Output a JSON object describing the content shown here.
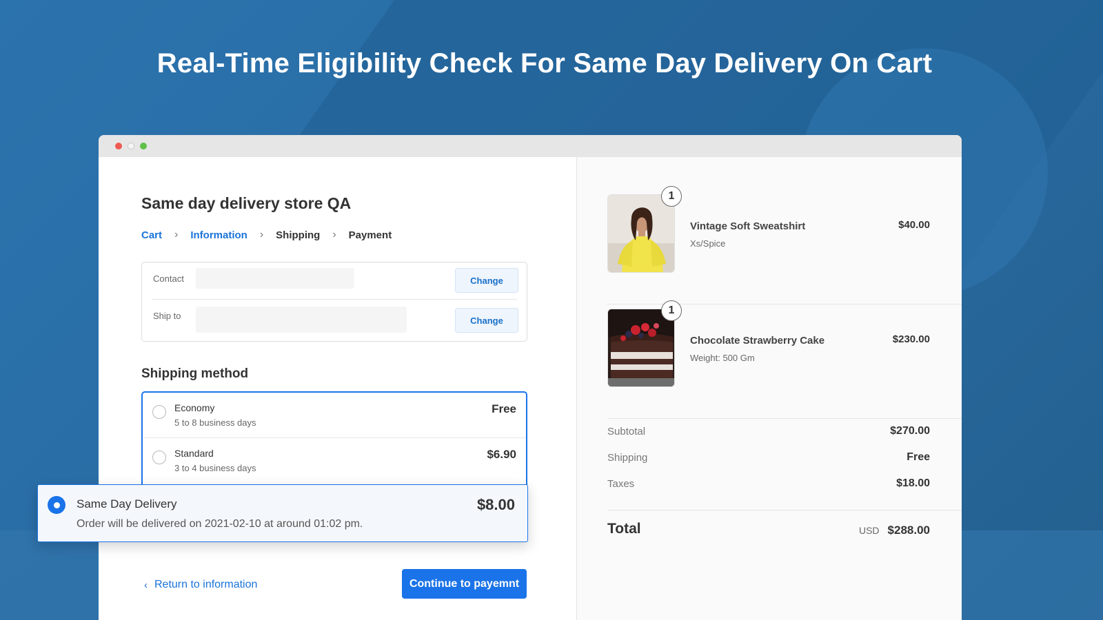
{
  "hero": {
    "title": "Real-Time Eligibility Check For Same Day Delivery On Cart"
  },
  "checkout": {
    "store_name": "Same day delivery store QA",
    "breadcrumb": [
      {
        "label": "Cart"
      },
      {
        "label": "Information"
      },
      {
        "label": "Shipping"
      },
      {
        "label": "Payment"
      }
    ],
    "contact": {
      "label": "Contact",
      "value": "",
      "action": "Change"
    },
    "ship_to": {
      "label": "Ship to",
      "value": "",
      "action": "Change"
    },
    "shipping_method_title": "Shipping method",
    "options": [
      {
        "name": "Economy",
        "desc": "5 to 8 business days",
        "price": "Free",
        "selected": false
      },
      {
        "name": "Standard",
        "desc": "3 to 4 business days",
        "price": "$6.90",
        "selected": false
      }
    ],
    "same_day": {
      "name": "Same Day Delivery",
      "desc": "Order will be delivered on 2021-02-10 at around 01:02 pm.",
      "price": "$8.00",
      "selected": true
    },
    "return_link": "Return to information",
    "continue_button": "Continue to payemnt"
  },
  "cart": {
    "items": [
      {
        "name": "Vintage Soft Sweatshirt",
        "variant": "Xs/Spice",
        "price": "$40.00",
        "qty": "1"
      },
      {
        "name": "Chocolate Strawberry Cake",
        "variant": "Weight: 500 Gm",
        "price": "$230.00",
        "qty": "1"
      }
    ],
    "summary": {
      "subtotal_label": "Subtotal",
      "subtotal": "$270.00",
      "shipping_label": "Shipping",
      "shipping": "Free",
      "taxes_label": "Taxes",
      "taxes": "$18.00"
    },
    "total": {
      "label": "Total",
      "currency": "USD",
      "value": "$288.00"
    }
  },
  "colors": {
    "accent": "#1a73e8",
    "background": "#2a6aa2"
  }
}
